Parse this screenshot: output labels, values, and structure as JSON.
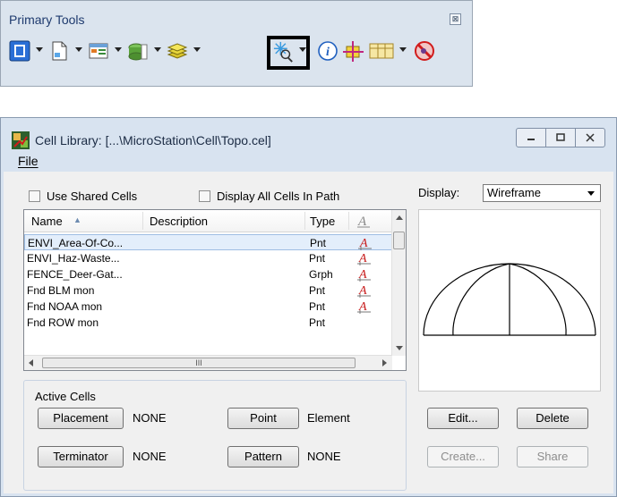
{
  "primary_tools": {
    "title": "Primary Tools",
    "close_glyph": "⊠",
    "tools": [
      {
        "icon": "workflow-icon",
        "has_dropdown": true
      },
      {
        "icon": "document-icon",
        "has_dropdown": true
      },
      {
        "icon": "cell-library-icon",
        "has_dropdown": true
      },
      {
        "icon": "level-manager-icon",
        "has_dropdown": true
      },
      {
        "icon": "layers-icon",
        "has_dropdown": true
      },
      {
        "icon": "cell-selector-icon",
        "has_dropdown": true,
        "highlighted": true
      },
      {
        "icon": "info-icon",
        "has_dropdown": false
      },
      {
        "icon": "accudraw-icon",
        "has_dropdown": false
      },
      {
        "icon": "view-table-icon",
        "has_dropdown": true
      },
      {
        "icon": "no-entry-icon",
        "has_dropdown": false
      }
    ]
  },
  "cell_library": {
    "title": "Cell Library: [...\\MicroStation\\Cell\\Topo.cel]",
    "menu": {
      "file": "File"
    },
    "use_shared_cells": "Use Shared Cells",
    "display_all_cells": "Display All Cells In Path",
    "display_label": "Display:",
    "display_value": "Wireframe",
    "columns": {
      "name": "Name",
      "description": "Description",
      "type": "Type"
    },
    "rows": [
      {
        "name": "ENVI_Area-Of-Co...",
        "type": "Pnt",
        "selected": true
      },
      {
        "name": "ENVI_Haz-Waste...",
        "type": "Pnt",
        "selected": false
      },
      {
        "name": "FENCE_Deer-Gat...",
        "type": "Grph",
        "selected": false
      },
      {
        "name": "Fnd BLM mon",
        "type": "Pnt",
        "selected": false
      },
      {
        "name": "Fnd NOAA mon",
        "type": "Pnt",
        "selected": false
      },
      {
        "name": "Fnd ROW mon",
        "type": "Pnt",
        "selected": false
      }
    ],
    "active_cells": {
      "label": "Active Cells",
      "placement_label": "Placement",
      "placement_value": "NONE",
      "point_label": "Point",
      "point_value": "Element",
      "terminator_label": "Terminator",
      "terminator_value": "NONE",
      "pattern_label": "Pattern",
      "pattern_value": "NONE"
    },
    "buttons": {
      "edit": "Edit...",
      "delete": "Delete",
      "create": "Create...",
      "share": "Share"
    }
  },
  "colors": {
    "accent": "#1e3a6e",
    "highlight_box": "#000000",
    "cell_type_icon": "#c81e1e"
  }
}
